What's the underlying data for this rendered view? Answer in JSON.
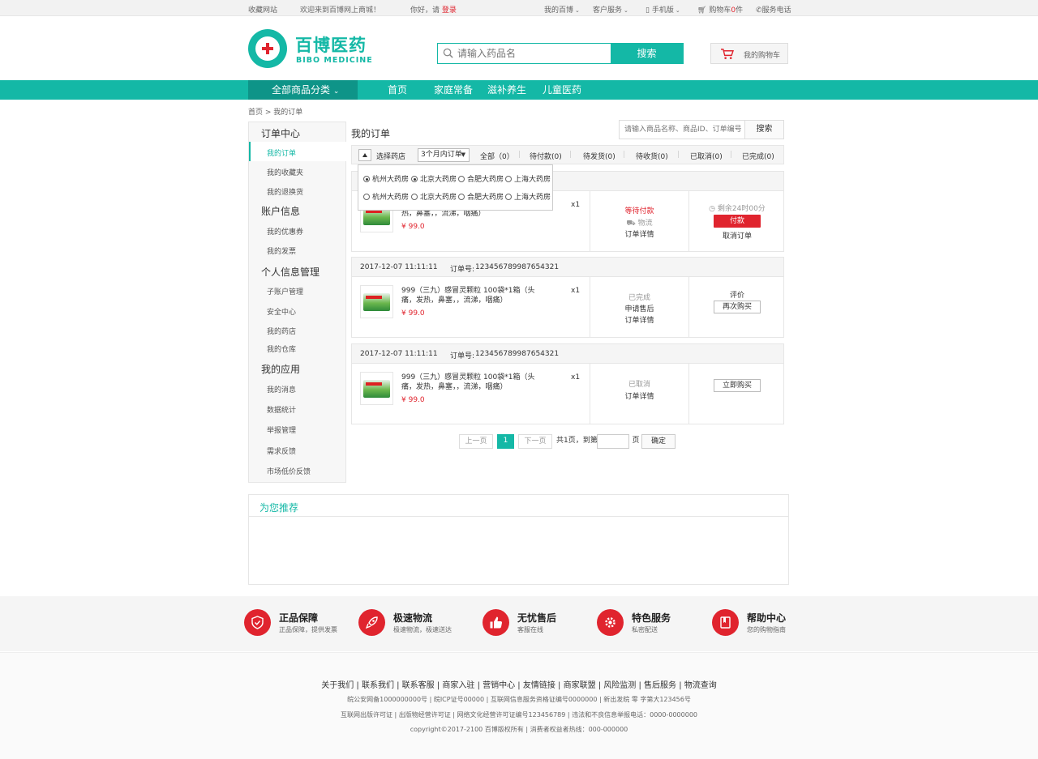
{
  "topbar": {
    "favorite": "收藏网站",
    "welcome": "欢迎来到百博网上商城！",
    "hello": "你好，请",
    "login": "登录",
    "my_bibo": "我的百博",
    "service": "客户服务",
    "mobile": "手机版",
    "cart_label": "购物车",
    "cart_count": "0",
    "cart_unit": "件",
    "phone": "服务电话"
  },
  "header": {
    "logo_cn": "百博医药",
    "logo_en": "BIBO MEDICINE",
    "search_placeholder": "请输入药品名",
    "search_btn": "搜索",
    "cart_btn": "我的购物车"
  },
  "nav": {
    "all": "全部商品分类",
    "items": [
      "首页",
      "家庭常备",
      "滋补养生",
      "儿童医药"
    ]
  },
  "breadcrumb": "首页 > 我的订单",
  "sidebar": {
    "order_center": "订单中心",
    "my_orders": "我的订单",
    "favorites": "我的收藏夹",
    "returns": "我的退换货",
    "account": "账户信息",
    "coupons": "我的优惠券",
    "invoices": "我的发票",
    "personal": "个人信息管理",
    "sub_account": "子账户管理",
    "security": "安全中心",
    "pharmacy": "我的药店",
    "warehouse": "我的仓库",
    "apps": "我的应用",
    "messages": "我的消息",
    "stats": "数据统计",
    "report": "举报管理",
    "feedback": "需求反馈",
    "market": "市场低价反馈"
  },
  "main": {
    "title": "我的订单",
    "search_placeholder": "请输入商品名称、商品ID、订单编号",
    "search_btn": "搜索",
    "choose_store": "选择药店",
    "period": "3个月内订单",
    "tabs": [
      "全部（0）",
      "待付款(0)",
      "待发货(0)",
      "待收货(0)",
      "已取消(0)",
      "已完成(0)"
    ],
    "stores": [
      "杭州大药房",
      "北京大药房",
      "合肥大药房",
      "上海大药房",
      "杭州大药房",
      "北京大药房",
      "合肥大药房",
      "上海大药房"
    ]
  },
  "orders": [
    {
      "name_visible": "热，鼻塞，，流涕，咽痛）",
      "price": "¥ 99.0",
      "qty": "x1",
      "status": "等待付款",
      "logistics": "物流",
      "detail": "订单详情",
      "remain": "剩余24时00分",
      "pay": "付款",
      "cancel": "取消订单"
    },
    {
      "date": "2017-12-07  11:11:11",
      "order_label": "订单号:",
      "order_no": "123456789987654321",
      "name": "999（三九）感冒灵颗粒  100袋*1箱（头痛，发热，鼻塞，，流涕，咽痛）",
      "price": "¥ 99.0",
      "qty": "x1",
      "status": "已完成",
      "after": "申请售后",
      "detail": "订单详情",
      "review": "评价",
      "rebuy": "再次购买"
    },
    {
      "date": "2017-12-07  11:11:11",
      "order_label": "订单号:",
      "order_no": "123456789987654321",
      "name": "999（三九）感冒灵颗粒  100袋*1箱（头痛，发热，鼻塞，，流涕，咽痛）",
      "price": "¥ 99.0",
      "qty": "x1",
      "status": "已取消",
      "detail": "订单详情",
      "buy": "立即购买"
    }
  ],
  "pagination": {
    "prev": "上一页",
    "current": "1",
    "next": "下一页",
    "total": "共1页，到第",
    "page": "页",
    "confirm": "确定"
  },
  "recommend": {
    "title": "为您推荐"
  },
  "features": [
    {
      "title": "正品保障",
      "sub": "正品保障，提供发票",
      "icon": "shield-icon"
    },
    {
      "title": "极速物流",
      "sub": "极速物流，极速送达",
      "icon": "rocket-icon"
    },
    {
      "title": "无忧售后",
      "sub": "客服在线",
      "icon": "thumbs-up-icon"
    },
    {
      "title": "特色服务",
      "sub": "私密配送",
      "icon": "gear-icon"
    },
    {
      "title": "帮助中心",
      "sub": "您的购物指南",
      "icon": "book-icon"
    }
  ],
  "footer": {
    "links": "关于我们  |  联系我们  |  联系客服  |  商家入驻  |  营销中心  |  友情链接  |  商家联盟  |  风险监测  |  售后服务  |  物流查询",
    "line1": "皖公安网备1000000000号  |  皖ICP证号00000  |  互联网信息服务资格证编号0000000  |  新出发皖 零  字第大123456号",
    "line2": "互联网出版许可证  |  出版物经营许可证  |  网络文化经营许可证编号123456789  |  违法和不良信息举报电话：0000-0000000",
    "line3": "copyright©2017-2100  百博版权所有  |  消费者权益者热线：000-000000"
  },
  "colors": {
    "accent": "#14b8a6",
    "accent_dark": "#0e9488",
    "red": "#e0242e"
  }
}
